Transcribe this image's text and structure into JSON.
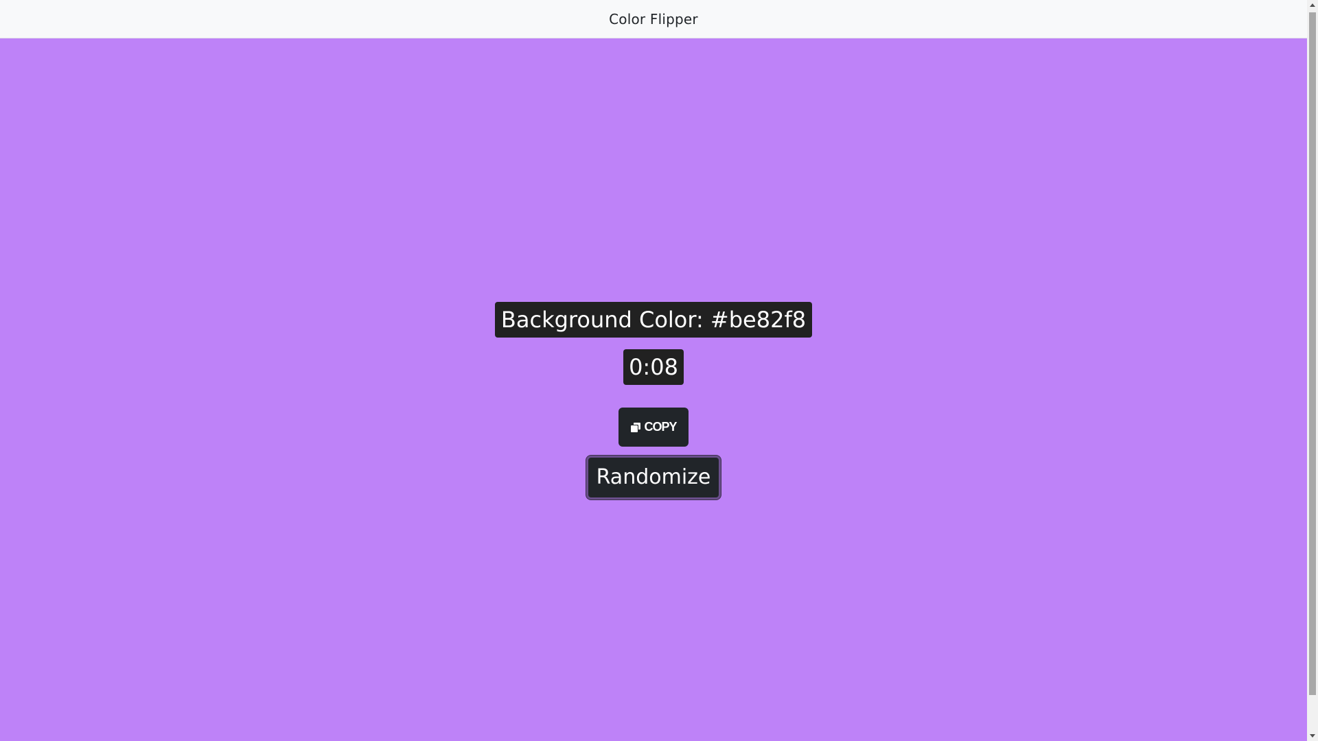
{
  "navbar": {
    "brand": "Color Flipper"
  },
  "main": {
    "color_label": "Background Color: #be82f8",
    "timer": "0:08",
    "copy_label": "COPY",
    "copy_icon": "copy-icon",
    "randomize_label": "Randomize"
  },
  "colors": {
    "background": "#be82f8",
    "navbar_bg": "#f8f9fa",
    "label_bg": "#212121",
    "button_bg": "#212529"
  }
}
